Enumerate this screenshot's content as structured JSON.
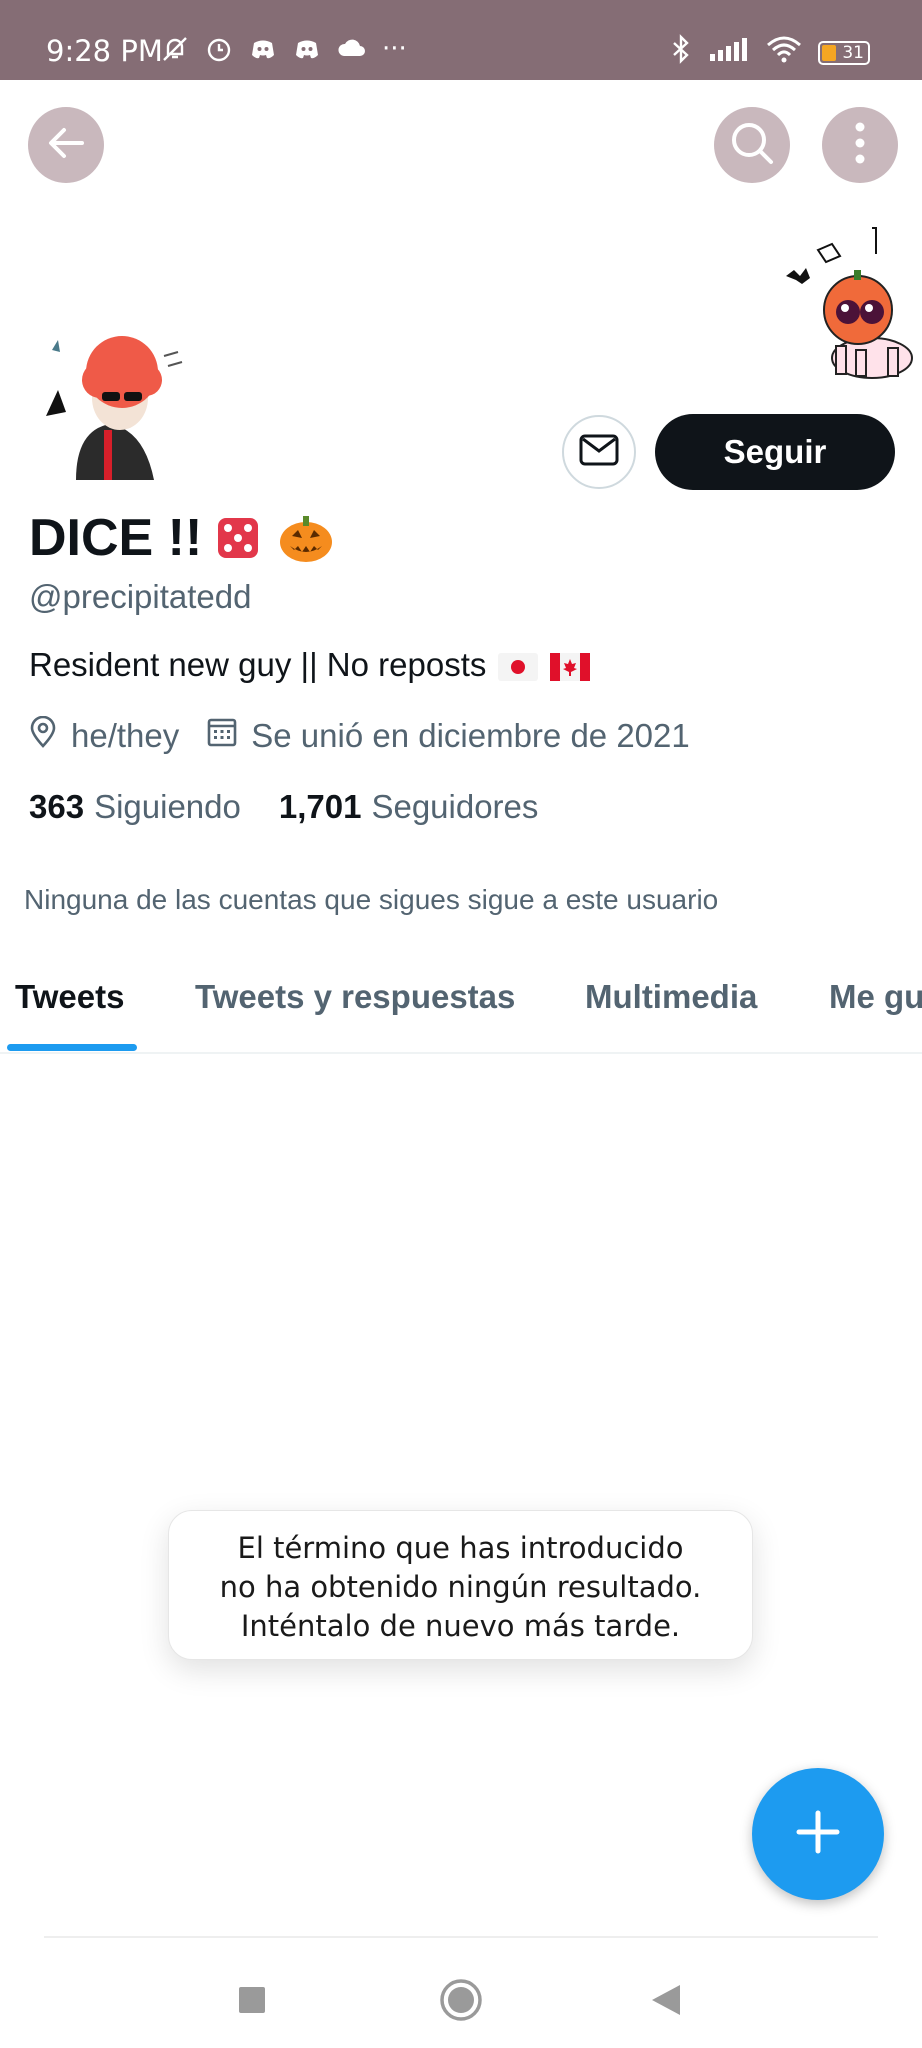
{
  "status_bar": {
    "time": "9:28 PM",
    "left_icons": [
      "muted-bell-icon",
      "alarm-icon",
      "discord-icon",
      "discord-icon",
      "cloud-icon",
      "more-dots"
    ],
    "more_dots": "···",
    "battery_level": "31"
  },
  "header": {
    "back_icon": "arrow-left-icon",
    "search_icon": "search-icon",
    "more_icon": "more-vertical-icon"
  },
  "profile": {
    "display_name": "DICE !!",
    "name_emojis": [
      "game-die",
      "jack-o-lantern"
    ],
    "handle": "@precipitatedd",
    "bio": "Resident new guy || No reposts",
    "bio_flags": [
      "japan-flag",
      "canada-flag"
    ],
    "pronouns": "he/they",
    "joined": "Se unió en diciembre de 2021",
    "following_count": "363",
    "following_label": "Siguiendo",
    "followers_count": "1,701",
    "followers_label": "Seguidores",
    "follow_button": "Seguir",
    "mutual_note": "Ninguna de las cuentas que sigues sigue a este usuario"
  },
  "tabs": [
    {
      "label": "Tweets",
      "active": true
    },
    {
      "label": "Tweets y respuestas",
      "active": false
    },
    {
      "label": "Multimedia",
      "active": false
    },
    {
      "label": "Me gu",
      "active": false
    }
  ],
  "toast": {
    "line1": "El término que has introducido",
    "line2": "no ha obtenido ningún resultado.",
    "line3": "Inténtalo de nuevo más tarde."
  },
  "colors": {
    "status_bar": "#856d75",
    "accent": "#1d9bf0",
    "follow_button_bg": "#0f1419",
    "secondary_text": "#536471"
  }
}
